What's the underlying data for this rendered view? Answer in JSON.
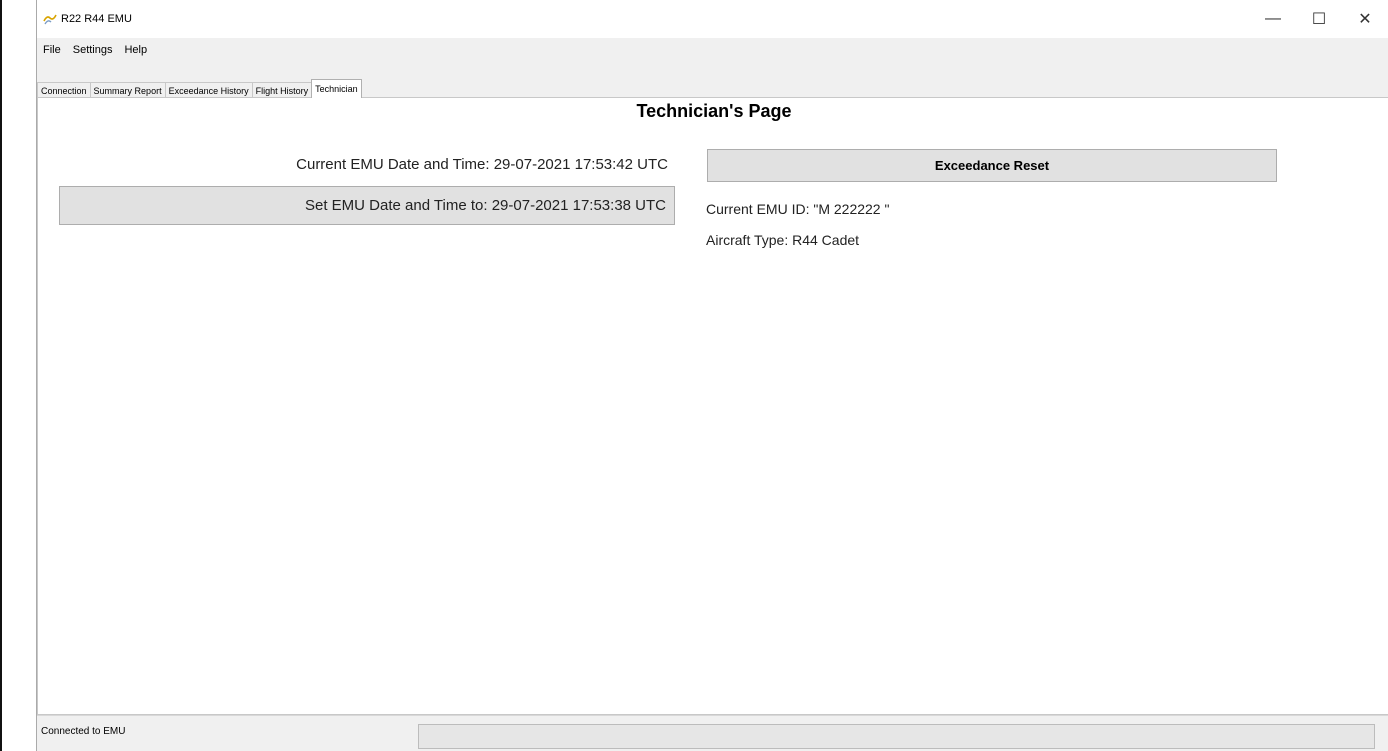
{
  "window": {
    "title": "R22 R44 EMU",
    "controls": {
      "minimize": "—",
      "maximize": "☐",
      "close": "✕"
    }
  },
  "menu": [
    "File",
    "Settings",
    "Help"
  ],
  "tabs": [
    {
      "label": "Connection",
      "active": false
    },
    {
      "label": "Summary Report",
      "active": false
    },
    {
      "label": "Exceedance History",
      "active": false
    },
    {
      "label": "Flight History",
      "active": false
    },
    {
      "label": "Technician",
      "active": true
    }
  ],
  "page": {
    "title": "Technician's Page",
    "current_time_label": "Current EMU Date and Time: 29-07-2021 17:53:42 UTC",
    "set_time_button": "Set EMU Date and Time to: 29-07-2021 17:53:38 UTC",
    "exceedance_reset_button": "Exceedance Reset",
    "emu_id": "Current EMU ID: \"M 222222 \"",
    "aircraft_type": "Aircraft Type: R44 Cadet"
  },
  "status": {
    "text": "Connected to EMU",
    "progress": 0
  },
  "icons": {
    "app": "helicopter-app-icon"
  },
  "colors": {
    "menu_bg": "#f0f0f0",
    "button_bg": "#e1e1e1",
    "content_bg": "#ffffff"
  }
}
